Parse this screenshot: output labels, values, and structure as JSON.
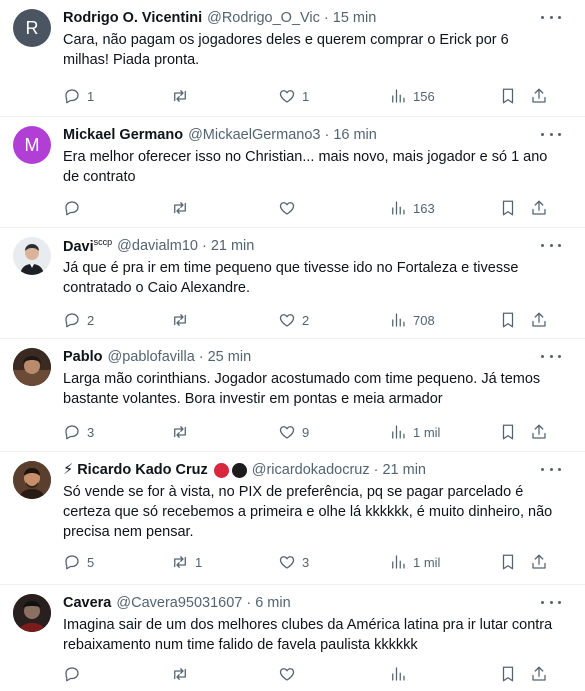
{
  "tweets": [
    {
      "name": "Rodrigo O. Vicentini",
      "handle": "@Rodrigo_O_Vic",
      "time": "15 min",
      "text": "Cara, não pagam os jogadores deles e querem comprar o Erick por 6 milhas! Piada pronta.",
      "avatar_letter": "R",
      "avatar_color": "#4a5561",
      "replies": "1",
      "retweets": "",
      "likes": "1",
      "views": "156"
    },
    {
      "name": "Mickael Germano",
      "handle": "@MickaelGermano3",
      "time": "16 min",
      "text": "Era melhor oferecer isso no Christian... mais novo, mais jogador e só 1 ano de contrato",
      "avatar_letter": "M",
      "avatar_color": "#b13fd6",
      "replies": "",
      "retweets": "",
      "likes": "",
      "views": "163"
    },
    {
      "name": "Davi",
      "name_sup": "sccp",
      "handle": "@davialm10",
      "time": "21 min",
      "text": "Já que é pra ir em time pequeno que tivesse ido no Fortaleza e tivesse contratado o Caio Alexandre.",
      "avatar_letter": "",
      "avatar_color": "#2b2f33",
      "replies": "2",
      "retweets": "",
      "likes": "2",
      "views": "708"
    },
    {
      "name": "Pablo",
      "handle": "@pablofavilla",
      "time": "25 min",
      "text": "Larga mão corinthians. Jogador acostumado com time pequeno. Já temos bastante volantes. Bora investir em pontas e meia armador",
      "avatar_letter": "",
      "avatar_color": "#3b2a22",
      "replies": "3",
      "retweets": "",
      "likes": "9",
      "views": "1 mil"
    },
    {
      "name": "⚡ Ricardo Kado Cruz",
      "handle": "@ricardokadocruz",
      "time": "21 min",
      "text": "Só vende se for à vista, no PIX de preferência, pq se pagar parcelado é certeza que só recebemos a primeira e olhe lá kkkkkk, é muito dinheiro, não precisa nem pensar.",
      "avatar_letter": "",
      "avatar_color": "#5a3f2e",
      "emoji_colors": [
        "#d7263d",
        "#1c1c1c"
      ],
      "replies": "5",
      "retweets": "1",
      "likes": "3",
      "views": "1 mil"
    },
    {
      "name": "Cavera",
      "handle": "@Cavera95031607",
      "time": "6 min",
      "text": "Imagina sair de um dos melhores clubes da América latina pra ir lutar contra rebaixamento num time falido de favela paulista kkkkkk",
      "avatar_letter": "",
      "avatar_color": "#2a1f1f",
      "replies": "",
      "retweets": "",
      "likes": "",
      "views": ""
    }
  ]
}
